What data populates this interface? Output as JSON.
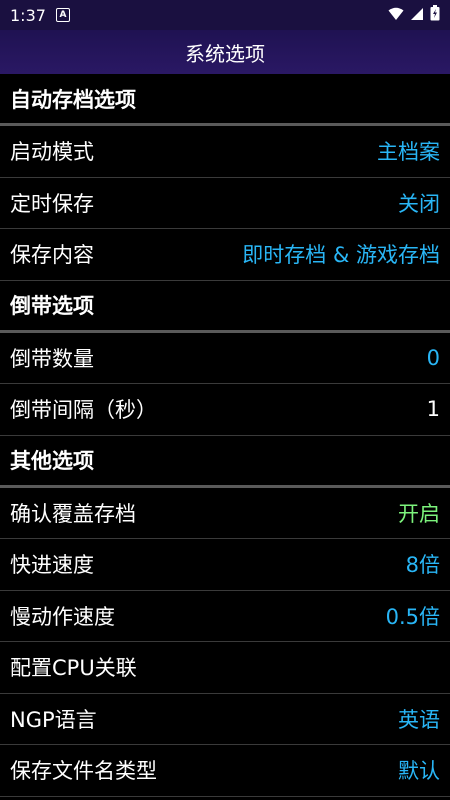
{
  "status_bar": {
    "time": "1:37",
    "notification_glyph": "A"
  },
  "appbar": {
    "title": "系统选项"
  },
  "colors": {
    "value_blue": "#29b6f6",
    "value_green": "#7cf37c",
    "appbar_bg": "#1f1252"
  },
  "sections": {
    "autosave": {
      "header": "自动存档选项",
      "items": [
        {
          "label": "启动模式",
          "value": "主档案"
        },
        {
          "label": "定时保存",
          "value": "关闭"
        },
        {
          "label": "保存内容",
          "value": "即时存档 & 游戏存档"
        }
      ]
    },
    "rewind": {
      "header": "倒带选项",
      "items": [
        {
          "label": "倒带数量",
          "value": "0"
        },
        {
          "label": "倒带间隔（秒）",
          "value": "1"
        }
      ]
    },
    "other": {
      "header": "其他选项",
      "items": [
        {
          "label": "确认覆盖存档",
          "value": "开启"
        },
        {
          "label": "快进速度",
          "value": "8倍"
        },
        {
          "label": "慢动作速度",
          "value": "0.5倍"
        },
        {
          "label": "配置CPU关联",
          "value": ""
        },
        {
          "label": "NGP语言",
          "value": "英语"
        },
        {
          "label": "保存文件名类型",
          "value": "默认"
        }
      ]
    }
  }
}
